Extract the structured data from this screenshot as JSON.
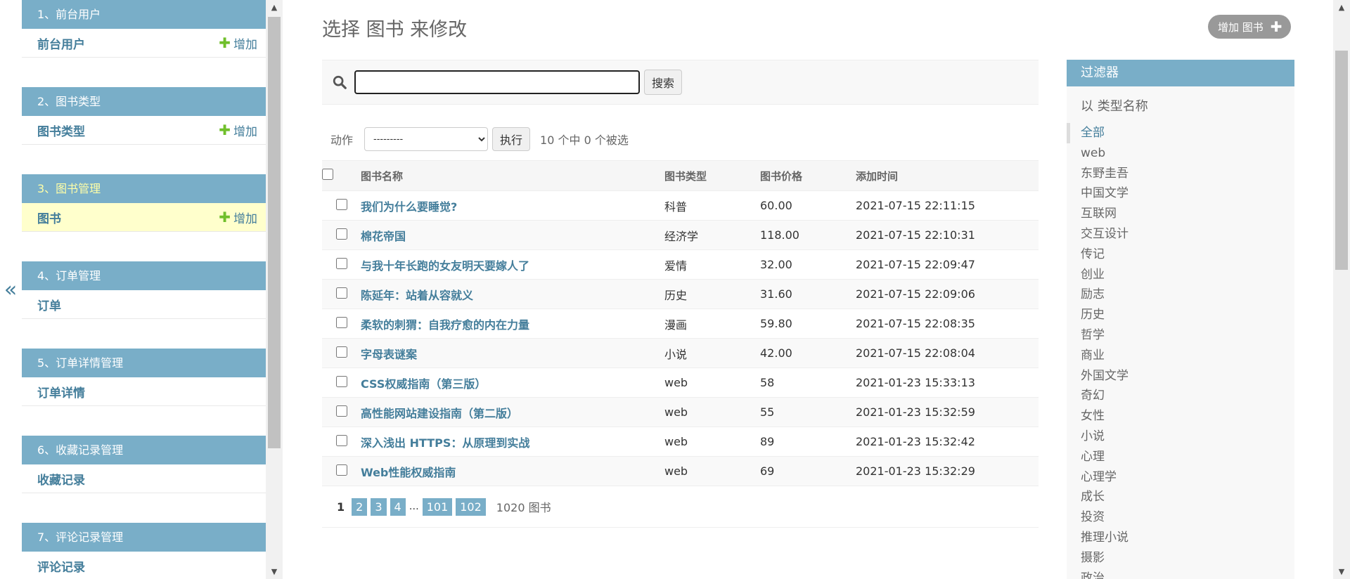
{
  "nav": {
    "collapse_label": "«",
    "modules": [
      {
        "title": "1、前台用户",
        "model": "前台用户",
        "add": "增加",
        "has_add": true,
        "active": false
      },
      {
        "title": "2、图书类型",
        "model": "图书类型",
        "add": "增加",
        "has_add": true,
        "active": false
      },
      {
        "title": "3、图书管理",
        "model": "图书",
        "add": "增加",
        "has_add": true,
        "active": true
      },
      {
        "title": "4、订单管理",
        "model": "订单",
        "add": "",
        "has_add": false,
        "active": false
      },
      {
        "title": "5、订单详情管理",
        "model": "订单详情",
        "add": "",
        "has_add": false,
        "active": false
      },
      {
        "title": "6、收藏记录管理",
        "model": "收藏记录",
        "add": "",
        "has_add": false,
        "active": false
      },
      {
        "title": "7、评论记录管理",
        "model": "评论记录",
        "add": "",
        "has_add": false,
        "active": false
      }
    ]
  },
  "main": {
    "title": "选择 图书 来修改",
    "add_button": "增加 图书",
    "search": {
      "value": "",
      "placeholder": "",
      "button": "搜索"
    },
    "actions": {
      "label": "动作",
      "selected": "---------",
      "run": "执行",
      "count": "10 个中 0 个被选"
    },
    "table": {
      "headers": [
        "图书名称",
        "图书类型",
        "图书价格",
        "添加时间"
      ],
      "rows": [
        {
          "name": "我们为什么要睡觉?",
          "type": "科普",
          "price": "60.00",
          "time": "2021-07-15 22:11:15"
        },
        {
          "name": "棉花帝国",
          "type": "经济学",
          "price": "118.00",
          "time": "2021-07-15 22:10:31"
        },
        {
          "name": "与我十年长跑的女友明天要嫁人了",
          "type": "爱情",
          "price": "32.00",
          "time": "2021-07-15 22:09:47"
        },
        {
          "name": "陈延年：站着从容就义",
          "type": "历史",
          "price": "31.60",
          "time": "2021-07-15 22:09:06"
        },
        {
          "name": "柔软的刺猬：自我疗愈的内在力量",
          "type": "漫画",
          "price": "59.80",
          "time": "2021-07-15 22:08:35"
        },
        {
          "name": "字母表谜案",
          "type": "小说",
          "price": "42.00",
          "time": "2021-07-15 22:08:04"
        },
        {
          "name": "CSS权威指南（第三版）",
          "type": "web",
          "price": "58",
          "time": "2021-01-23 15:33:13"
        },
        {
          "name": "高性能网站建设指南（第二版）",
          "type": "web",
          "price": "55",
          "time": "2021-01-23 15:32:59"
        },
        {
          "name": "深入浅出 HTTPS：从原理到实战",
          "type": "web",
          "price": "89",
          "time": "2021-01-23 15:32:42"
        },
        {
          "name": "Web性能权威指南",
          "type": "web",
          "price": "69",
          "time": "2021-01-23 15:32:29"
        }
      ]
    },
    "pagination": {
      "current": "1",
      "pages": [
        "2",
        "3",
        "4"
      ],
      "ellipsis": "…",
      "last_pages": [
        "101",
        "102"
      ],
      "count": "1020 图书"
    }
  },
  "filter": {
    "title": "过滤器",
    "subtitle": "以 类型名称",
    "options": [
      "全部",
      "web",
      "东野圭吾",
      "中国文学",
      "互联网",
      "交互设计",
      "传记",
      "创业",
      "励志",
      "历史",
      "哲学",
      "商业",
      "外国文学",
      "奇幻",
      "女性",
      "小说",
      "心理",
      "心理学",
      "成长",
      "投资",
      "推理小说",
      "摄影",
      "政治"
    ],
    "selected_index": 0
  },
  "colors": {
    "header_blue": "#79aec8",
    "link_blue": "#447e9b",
    "add_green": "#70bf2b",
    "selected_row": "#ffffcc"
  }
}
